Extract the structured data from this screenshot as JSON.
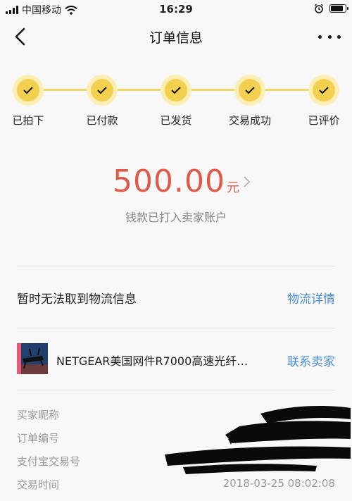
{
  "status_bar": {
    "carrier": "中国移动",
    "time": "16:29",
    "battery_level": 0.9
  },
  "nav": {
    "title": "订单信息"
  },
  "progress": {
    "accent": "#f3d050",
    "steps": [
      {
        "label": "已拍下"
      },
      {
        "label": "已付款"
      },
      {
        "label": "已发货"
      },
      {
        "label": "交易成功"
      },
      {
        "label": "已评价"
      }
    ]
  },
  "amount": {
    "value": "500.00",
    "unit": "元",
    "note": "钱款已打入卖家账户"
  },
  "logistics": {
    "status": "暂时无法取到物流信息",
    "link": "物流详情"
  },
  "product": {
    "name": "NETGEAR美国网件R7000高速光纤…",
    "contact": "联系卖家"
  },
  "order_info": {
    "buyer_label": "买家昵称",
    "order_no_label": "订单编号",
    "alipay_no_label": "支付宝交易号",
    "time_label": "交易时间",
    "time_value": "2018-03-25 08:02:08"
  },
  "colors": {
    "amount": "#e05a4a",
    "link": "#4a8dd6"
  }
}
